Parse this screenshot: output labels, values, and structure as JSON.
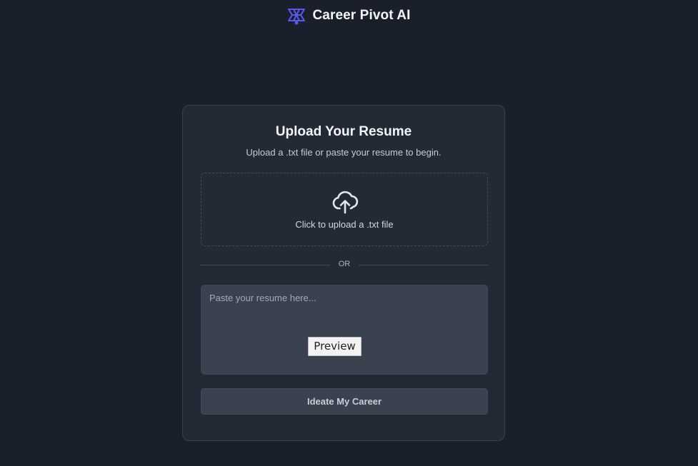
{
  "header": {
    "app_title": "Career Pivot AI",
    "logo_icon": "brain-circuit-icon",
    "logo_color": "#5b56f0"
  },
  "card": {
    "title": "Upload Your Resume",
    "subtitle": "Upload a .txt file or paste your resume to begin."
  },
  "upload": {
    "icon": "cloud-upload-icon",
    "label": "Click to upload a .txt file"
  },
  "divider": {
    "text": "OR"
  },
  "resume_input": {
    "value": "",
    "placeholder": "Paste your resume here..."
  },
  "preview_button": {
    "label": "Preview"
  },
  "submit_button": {
    "label": "Ideate My Career"
  },
  "colors": {
    "background": "#1a202b",
    "card": "#222a36",
    "input": "#3a4250",
    "accent": "#5b56f0"
  }
}
